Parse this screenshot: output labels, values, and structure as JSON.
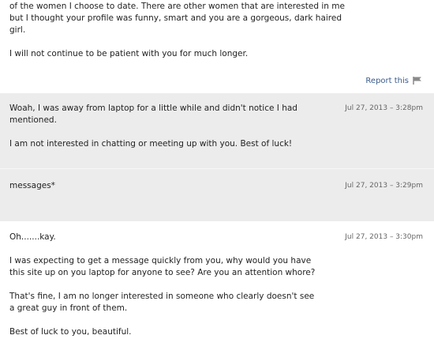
{
  "messages": [
    {
      "paragraphs": [
        "of the women I choose to date. There are other women that are interested in me but I thought your profile was funny, smart and you are a gorgeous, dark haired girl.",
        "I will not continue to be patient with you for much longer."
      ],
      "timestamp": "",
      "report_label": "Report this"
    },
    {
      "paragraphs": [
        "Woah, I was away from laptop for a little while and didn't notice I had mentioned.",
        "I am not interested in chatting or meeting up with you. Best of luck!"
      ],
      "timestamp": "Jul 27, 2013 – 3:28pm"
    },
    {
      "paragraphs": [
        "messages*"
      ],
      "timestamp": "Jul 27, 2013 – 3:29pm"
    },
    {
      "paragraphs": [
        "Oh.......kay.",
        "I was expecting to get a message quickly from you, why would you have this site up on you laptop for anyone to see? Are you an attention whore?",
        "That's fine, I am no longer interested in someone who clearly doesn't see a great guy in front of them.",
        "Best of luck to you, beautiful."
      ],
      "timestamp": "Jul 27, 2013 – 3:30pm"
    }
  ],
  "icons": {
    "report": "flag-icon"
  },
  "colors": {
    "gray_bg": "#ececec",
    "link": "#3b5b8c",
    "timestamp": "#666666"
  }
}
